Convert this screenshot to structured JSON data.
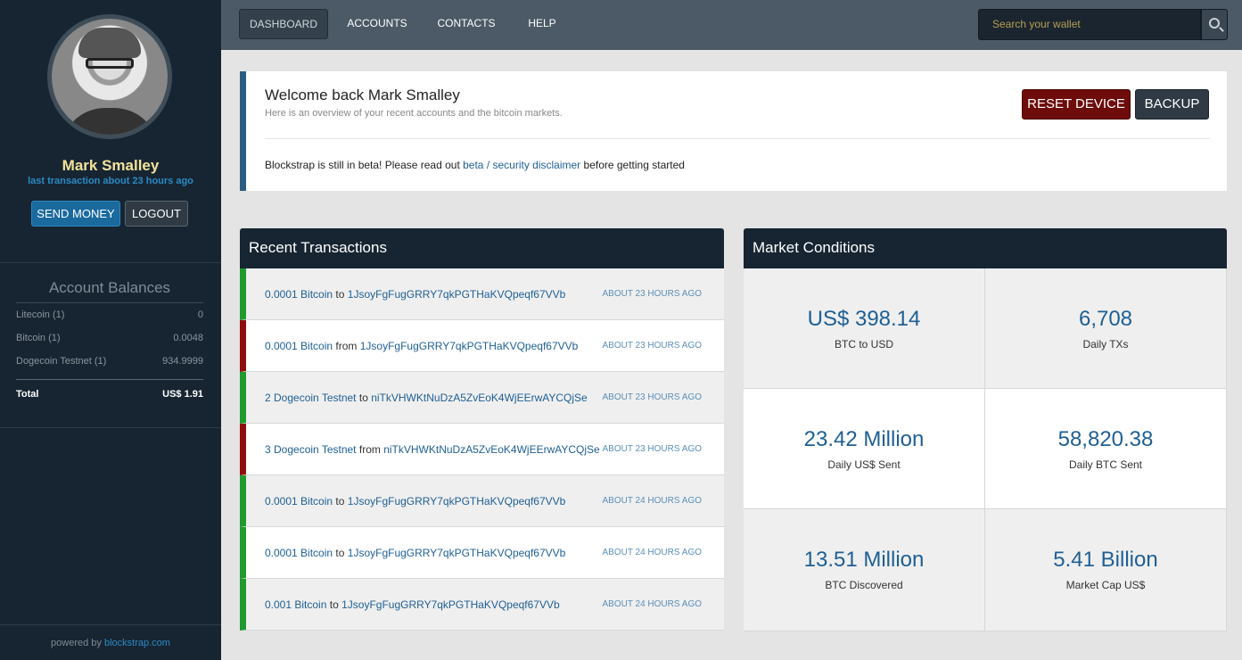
{
  "sidebar": {
    "user": {
      "name": "Mark Smalley",
      "subtitle": "last transaction about 23 hours ago"
    },
    "buttons": {
      "send": "SEND MONEY",
      "logout": "LOGOUT"
    },
    "balances": {
      "title": "Account Balances",
      "items": [
        {
          "label": "Litecoin (1)",
          "value": "0"
        },
        {
          "label": "Bitcoin (1)",
          "value": "0.0048"
        },
        {
          "label": "Dogecoin Testnet (1)",
          "value": "934.9999"
        }
      ],
      "total": {
        "label": "Total",
        "value": "US$ 1.91"
      }
    },
    "footer": {
      "prefix": "powered by",
      "link": "blockstrap.com"
    }
  },
  "nav": {
    "items": [
      {
        "label": "DASHBOARD",
        "active": true
      },
      {
        "label": "ACCOUNTS",
        "active": false
      },
      {
        "label": "CONTACTS",
        "active": false
      },
      {
        "label": "HELP",
        "active": false
      }
    ],
    "search": {
      "placeholder": "Search your wallet",
      "icon": "search-icon"
    }
  },
  "welcome": {
    "title": "Welcome back Mark Smalley",
    "subtitle": "Here is an overview of your recent accounts and the bitcoin markets.",
    "reset_label": "RESET DEVICE",
    "backup_label": "BACKUP",
    "beta": {
      "before": "Blockstrap is still in beta! Please read out",
      "link": "beta / security disclaimer",
      "after": "before getting started"
    }
  },
  "transactions": {
    "title": "Recent Transactions",
    "rows": [
      {
        "amount": "0.0001 Bitcoin",
        "dir": "to",
        "address": "1JsoyFgFugGRRY7qkPGTHaKVQpeqf67VVb",
        "time": "ABOUT 23 HOURS AGO",
        "type": "in"
      },
      {
        "amount": "0.0001 Bitcoin",
        "dir": "from",
        "address": "1JsoyFgFugGRRY7qkPGTHaKVQpeqf67VVb",
        "time": "ABOUT 23 HOURS AGO",
        "type": "out"
      },
      {
        "amount": "2 Dogecoin Testnet",
        "dir": "to",
        "address": "niTkVHWKtNuDzA5ZvEoK4WjEErwAYCQjSe",
        "time": "ABOUT 23 HOURS AGO",
        "type": "in"
      },
      {
        "amount": "3 Dogecoin Testnet",
        "dir": "from",
        "address": "niTkVHWKtNuDzA5ZvEoK4WjEErwAYCQjSe",
        "time": "ABOUT 23 HOURS AGO",
        "type": "out"
      },
      {
        "amount": "0.0001 Bitcoin",
        "dir": "to",
        "address": "1JsoyFgFugGRRY7qkPGTHaKVQpeqf67VVb",
        "time": "ABOUT 24 HOURS AGO",
        "type": "in"
      },
      {
        "amount": "0.0001 Bitcoin",
        "dir": "to",
        "address": "1JsoyFgFugGRRY7qkPGTHaKVQpeqf67VVb",
        "time": "ABOUT 24 HOURS AGO",
        "type": "in"
      },
      {
        "amount": "0.001 Bitcoin",
        "dir": "to",
        "address": "1JsoyFgFugGRRY7qkPGTHaKVQpeqf67VVb",
        "time": "ABOUT 24 HOURS AGO",
        "type": "in"
      }
    ]
  },
  "market": {
    "title": "Market Conditions",
    "cells": [
      {
        "value": "US$ 398.14",
        "label": "BTC to USD"
      },
      {
        "value": "6,708",
        "label": "Daily TXs"
      },
      {
        "value": "23.42 Million",
        "label": "Daily US$ Sent"
      },
      {
        "value": "58,820.38",
        "label": "Daily BTC Sent"
      },
      {
        "value": "13.51 Million",
        "label": "BTC Discovered"
      },
      {
        "value": "5.41 Billion",
        "label": "Market Cap US$"
      }
    ]
  },
  "colors": {
    "incoming": "#1e9a2e",
    "outgoing": "#8f0d0d",
    "accent": "#1e5f94",
    "sidebar": "#172532"
  }
}
